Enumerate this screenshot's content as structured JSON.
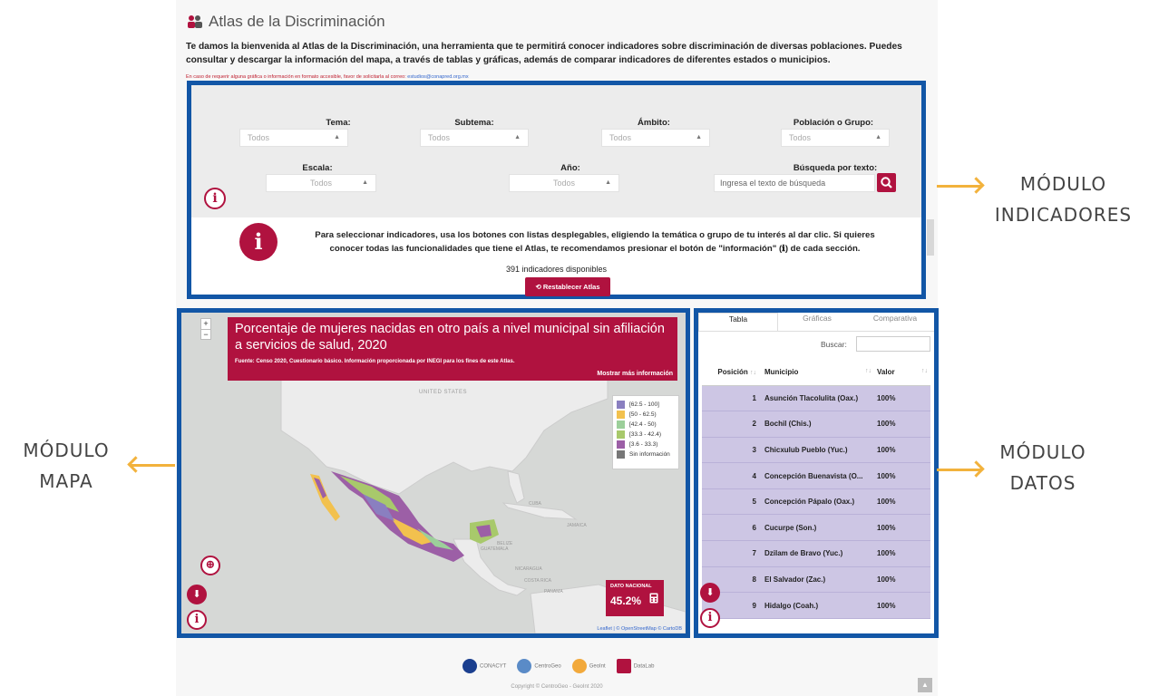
{
  "header": {
    "title": "Atlas de la Discriminación",
    "intro": "Te damos la bienvenida al Atlas de la Discriminación, una herramienta que te permitirá conocer indicadores sobre discriminación de diversas poblaciones. Puedes consultar y descargar la información del mapa, a través de tablas y gráficas, además de comparar indicadores de diferentes estados o municipios.",
    "notice": "En caso de requerir alguna gráfica o información en formato accesible, favor de solicitarla al correo:",
    "notice_email": "estudios@conapred.org.mx"
  },
  "filters": {
    "tema": {
      "label": "Tema:",
      "value": "Todos"
    },
    "subtema": {
      "label": "Subtema:",
      "value": "Todos"
    },
    "ambito": {
      "label": "Ámbito:",
      "value": "Todos"
    },
    "poblacion": {
      "label": "Población o Grupo:",
      "value": "Todos"
    },
    "escala": {
      "label": "Escala:",
      "value": "Todos"
    },
    "anio": {
      "label": "Año:",
      "value": "Todos"
    },
    "busqueda": {
      "label": "Búsqueda por texto:",
      "placeholder": "Ingresa el texto de búsqueda"
    }
  },
  "help_text": "Para seleccionar indicadores, usa los botones con listas desplegables, eligiendo la temática o grupo de tu interés al dar clic. Si quieres conocer todas las funcionalidades que tiene el Atlas, te recomendamos presionar el botón de \"información\" (ℹ) de cada sección.",
  "indicator_count": "391 indicadores disponibles",
  "reset_label": "Restablecer Atlas",
  "map": {
    "zoom_in": "+",
    "zoom_out": "−",
    "title": "Porcentaje de mujeres nacidas en otro país a nivel municipal sin afiliación a servicios de salud, 2020",
    "source": "Fuente: Censo 2020, Cuestionario básico. Información proporcionada por INEGI para los fines de este Atlas.",
    "more": "Mostrar más información",
    "labels": [
      "UNITED STATES",
      "CUBA",
      "JAMAICA",
      "BELIZE",
      "GUATEMALA",
      "NICARAGUA",
      "COSTA RICA",
      "PANAMA"
    ],
    "legend": [
      {
        "label": "[62.5 - 100]",
        "color": "#8a7fc0"
      },
      {
        "label": "[50 - 62.5)",
        "color": "#f2c14e"
      },
      {
        "label": "[42.4 - 50)",
        "color": "#9ccf9a"
      },
      {
        "label": "[33.3 - 42.4)",
        "color": "#a8c96b"
      },
      {
        "label": "[3.6 - 33.3)",
        "color": "#9c5fa6"
      },
      {
        "label": "Sin información",
        "color": "#777777"
      }
    ],
    "dato_label": "DATO NACIONAL",
    "dato_value": "45.2%",
    "attribution": "Leaflet | © OpenStreetMap © CartoDB"
  },
  "data": {
    "tabs": [
      "Tabla",
      "Gráficas",
      "Comparativa"
    ],
    "buscar": "Buscar:",
    "columns": [
      "Posición",
      "Municipio",
      "Valor"
    ],
    "rows": [
      {
        "pos": "1",
        "mun": "Asunción Tlacolulita (Oax.)",
        "val": "100%"
      },
      {
        "pos": "2",
        "mun": "Bochil (Chis.)",
        "val": "100%"
      },
      {
        "pos": "3",
        "mun": "Chicxulub Pueblo (Yuc.)",
        "val": "100%"
      },
      {
        "pos": "4",
        "mun": "Concepción Buenavista (O...",
        "val": "100%"
      },
      {
        "pos": "5",
        "mun": "Concepción Pápalo (Oax.)",
        "val": "100%"
      },
      {
        "pos": "6",
        "mun": "Cucurpe (Son.)",
        "val": "100%"
      },
      {
        "pos": "7",
        "mun": "Dzilam de Bravo (Yuc.)",
        "val": "100%"
      },
      {
        "pos": "8",
        "mun": "El Salvador (Zac.)",
        "val": "100%"
      },
      {
        "pos": "9",
        "mun": "Hidalgo (Coah.)",
        "val": "100%"
      }
    ]
  },
  "annotations": {
    "indicadores": [
      "MÓDULO",
      "INDICADORES"
    ],
    "mapa": [
      "MÓDULO",
      "MAPA"
    ],
    "datos": [
      "MÓDULO",
      "DATOS"
    ]
  },
  "footer": {
    "logos": [
      "CONACYT",
      "CentroGeo",
      "GeoInt",
      "DataLab"
    ],
    "copyright": "Copyright © CentroGeo - GeoInt 2020"
  },
  "colors": {
    "brand": "#b0123f",
    "annotation_border": "#1256a6",
    "arrow": "#f2b23c"
  }
}
